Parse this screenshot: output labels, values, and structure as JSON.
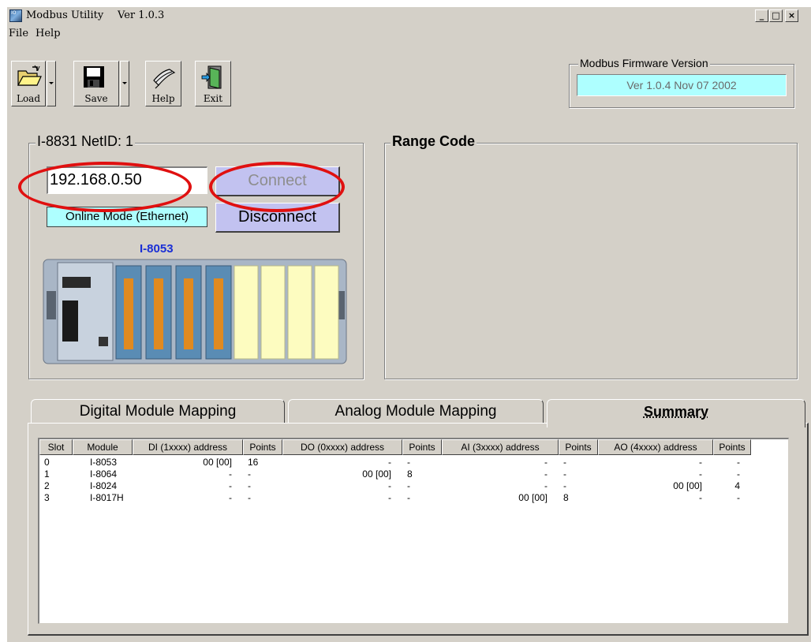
{
  "window": {
    "title": "Modbus Utility",
    "version": "Ver 1.0.3",
    "app_icon_text": "IO"
  },
  "menu": [
    "File",
    "Help"
  ],
  "toolbar": {
    "load_label": "Load",
    "save_label": "Save",
    "help_label": "Help",
    "exit_label": "Exit"
  },
  "firmware": {
    "group_title": "Modbus Firmware Version",
    "value": "Ver 1.0.4  Nov 07 2002"
  },
  "device": {
    "group_title": "I-8831  NetID: 1",
    "ip_value": "192.168.0.50",
    "connect_label": "Connect",
    "disconnect_label": "Disconnect",
    "mode": "Online Mode (Ethernet)",
    "module_model": "I-8053"
  },
  "range_code": {
    "group_title": "Range Code"
  },
  "tabs": [
    {
      "label": "Digital Module Mapping",
      "active": false
    },
    {
      "label": "Analog Module Mapping",
      "active": false
    },
    {
      "label": "Summary",
      "active": true
    }
  ],
  "table": {
    "columns": [
      "Slot",
      "Module",
      "DI (1xxxx) address",
      "Points",
      "DO (0xxxx) address",
      "Points",
      "AI (3xxxx) address",
      "Points",
      "AO (4xxxx) address",
      "Points"
    ],
    "rows": [
      [
        "0",
        "I-8053",
        "00 [00]",
        "16",
        "-",
        "-",
        "-",
        "-",
        "-",
        "-"
      ],
      [
        "1",
        "I-8064",
        "-",
        "-",
        "00 [00]",
        "8",
        "-",
        "-",
        "-",
        "-"
      ],
      [
        "2",
        "I-8024",
        "-",
        "-",
        "-",
        "-",
        "-",
        "-",
        "00 [00]",
        "4"
      ],
      [
        "3",
        "I-8017H",
        "-",
        "-",
        "-",
        "-",
        "00 [00]",
        "8",
        "-",
        "-"
      ]
    ]
  },
  "colors": {
    "window_bg": "#d4d0c8",
    "highlight_field": "#aeffff",
    "button_lavender": "#c2c2f0",
    "annotation_red": "#e01010",
    "model_blue": "#1a2fd6"
  }
}
